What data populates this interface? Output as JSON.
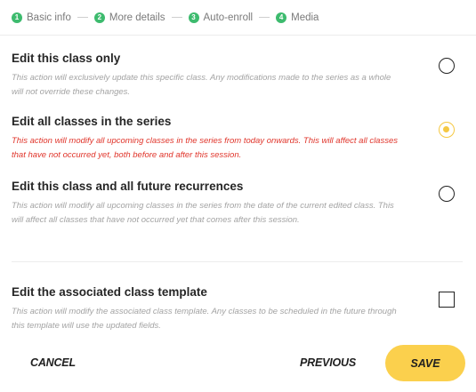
{
  "stepper": {
    "steps": [
      {
        "number": "1",
        "label": "Basic info"
      },
      {
        "number": "2",
        "label": "More details"
      },
      {
        "number": "3",
        "label": "Auto-enroll"
      },
      {
        "number": "4",
        "label": "Media"
      }
    ],
    "complete_color": "#3dbb6e"
  },
  "options": [
    {
      "title": "Edit this class only",
      "description": "This action will exclusively update this specific class. Any modifications made to the series as a whole will not override these changes.",
      "selected": false
    },
    {
      "title": "Edit all classes in the series",
      "description": "This action will modify all upcoming classes in the series from today onwards. This will affect all classes that have not occurred yet, both before and after this session.",
      "selected": true
    },
    {
      "title": "Edit this class and all future recurrences",
      "description": "This action will modify all upcoming classes in the series from the date of the current edited class. This will affect all classes that have not occurred yet that comes after this session.",
      "selected": false
    }
  ],
  "template_option": {
    "title": "Edit the associated class template",
    "description": "This action will modify the associated class template. Any classes to be scheduled in the future through this template will use the updated fields.",
    "checked": false
  },
  "footer": {
    "cancel_label": "CANCEL",
    "previous_label": "PREVIOUS",
    "save_label": "SAVE"
  },
  "colors": {
    "accent": "#fbd04d",
    "warning_text": "#e0352b"
  }
}
